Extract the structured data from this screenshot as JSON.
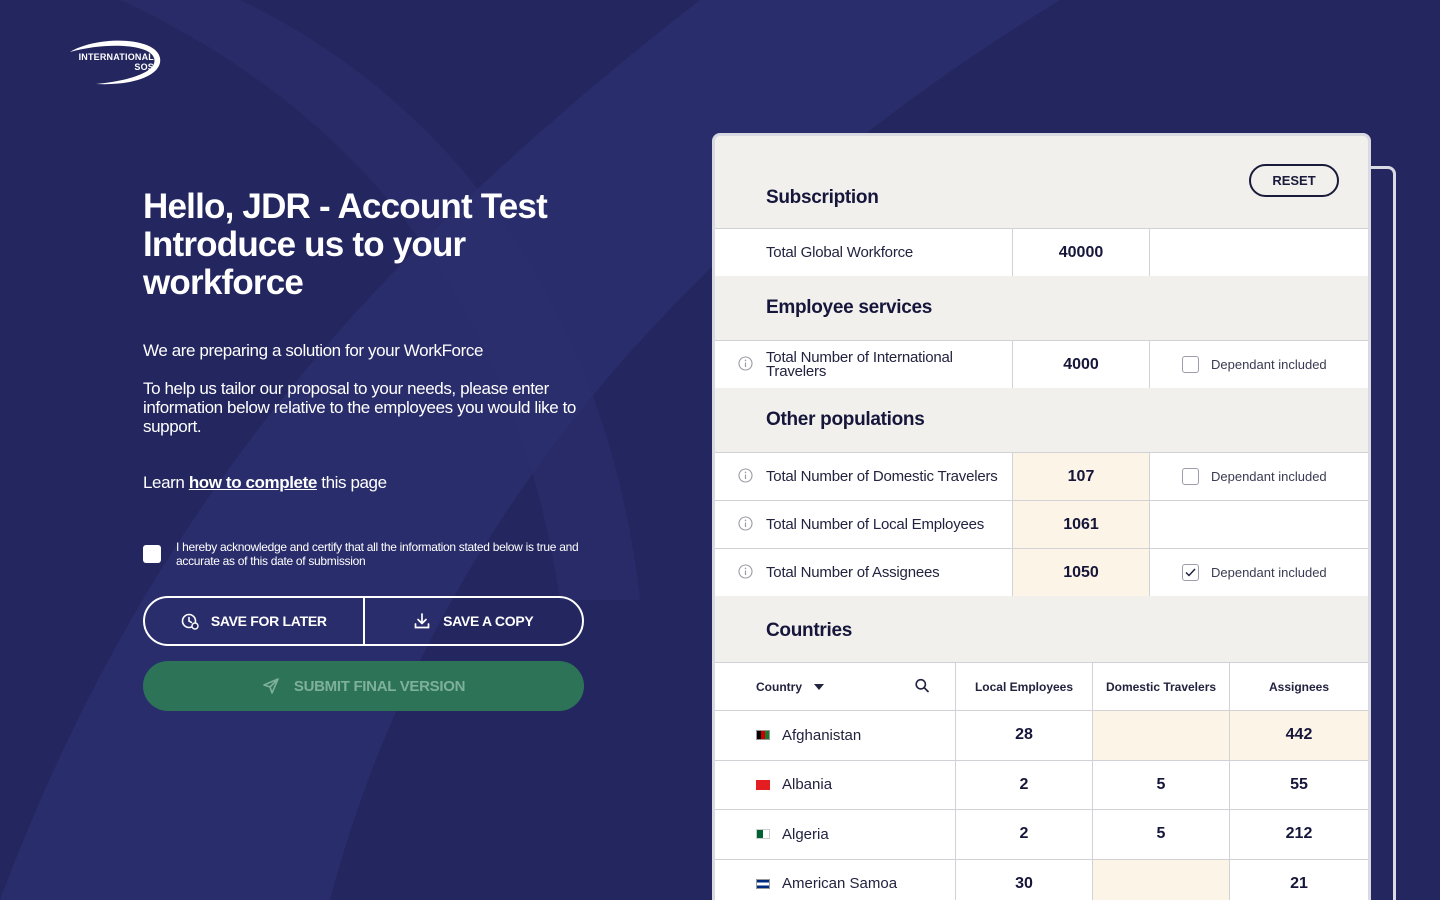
{
  "brand": {
    "logo_line1": "INTERNATIONAL",
    "logo_line2": "SOS"
  },
  "hero": {
    "line1": "Hello, JDR - Account Test",
    "line2": "Introduce us to your",
    "line3": "workforce"
  },
  "intro": {
    "p1": "We are preparing a solution for your WorkForce",
    "p2": "To help us tailor our proposal to your needs, please enter information below relative to the employees you would like to support."
  },
  "learn": {
    "prefix": "Learn ",
    "link": "how to complete",
    "suffix": " this page"
  },
  "ack": {
    "text": "I hereby acknowledge and certify that all the information stated below is true and accurate as of this date of submission",
    "checked": false
  },
  "actions": {
    "save_later": "SAVE FOR LATER",
    "save_copy": "SAVE A COPY",
    "submit": "SUBMIT FINAL VERSION"
  },
  "panel": {
    "reset": "RESET",
    "subscription": {
      "title": "Subscription",
      "label": "Total Global Workforce",
      "value": "40000"
    },
    "employee_services": {
      "title": "Employee services",
      "label": "Total Number of International Travelers",
      "value": "4000",
      "dependant_label": "Dependant included",
      "dependant_checked": false
    },
    "other_populations": {
      "title": "Other populations",
      "rows": [
        {
          "label": "Total Number of Domestic Travelers",
          "value": "107",
          "dependant_label": "Dependant included",
          "dependant_checked": false
        },
        {
          "label": "Total Number of Local Employees",
          "value": "1061"
        },
        {
          "label": "Total Number of Assignees",
          "value": "1050",
          "dependant_label": "Dependant included",
          "dependant_checked": true
        }
      ]
    },
    "countries": {
      "title": "Countries",
      "headers": {
        "country": "Country",
        "local": "Local Employees",
        "domestic": "Domestic Travelers",
        "assignees": "Assignees"
      },
      "rows": [
        {
          "name": "Afghanistan",
          "local": "28",
          "domestic": "",
          "assignees": "442"
        },
        {
          "name": "Albania",
          "local": "2",
          "domestic": "5",
          "assignees": "55"
        },
        {
          "name": "Algeria",
          "local": "2",
          "domestic": "5",
          "assignees": "212"
        },
        {
          "name": "American Samoa",
          "local": "30",
          "domestic": "",
          "assignees": "21"
        }
      ]
    }
  },
  "colors": {
    "background": "#23265f",
    "submit_bg": "#2c7358",
    "highlight": "#fcf4e6",
    "panel_bg": "#f1f0ed"
  }
}
